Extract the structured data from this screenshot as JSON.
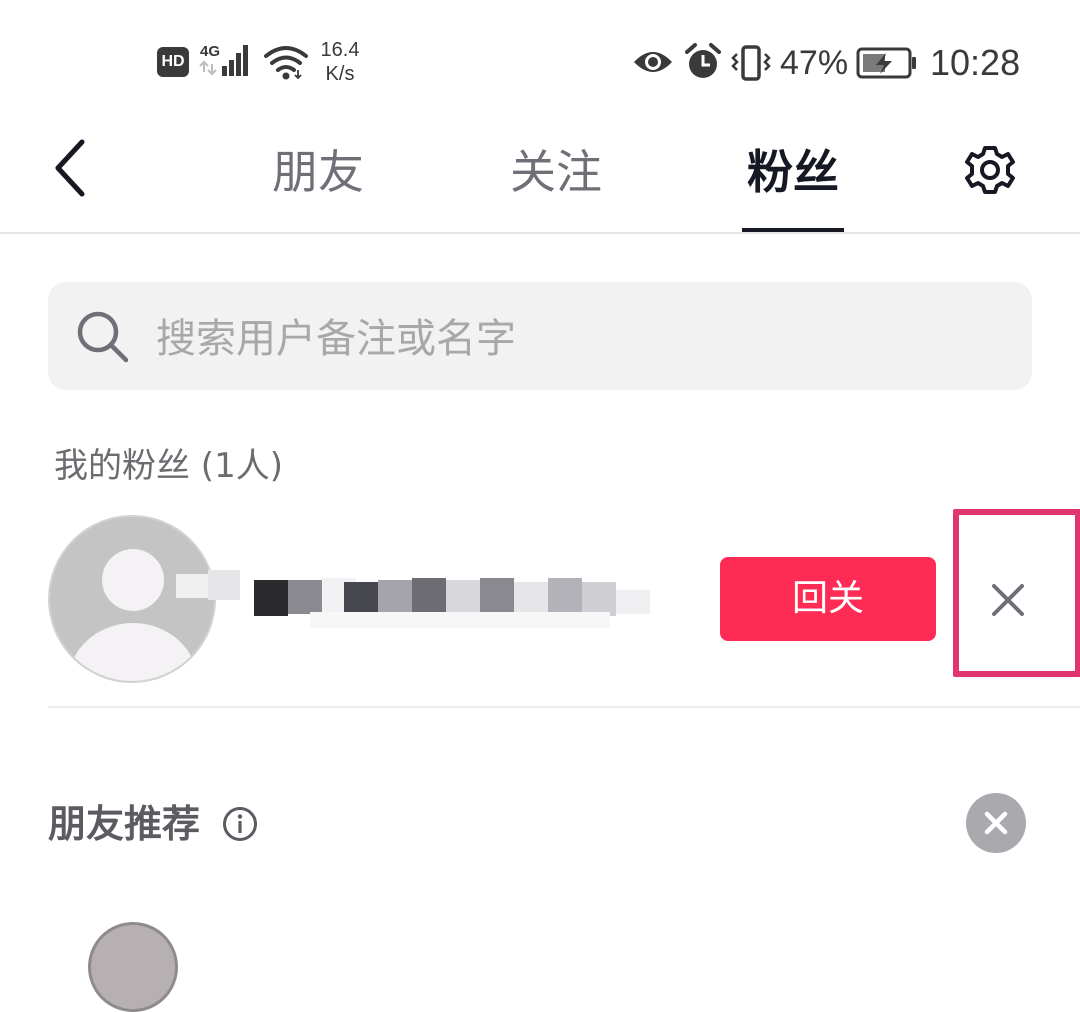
{
  "status_bar": {
    "hd_label": "HD",
    "network_label": "4G",
    "net_speed_value": "16.4",
    "net_speed_unit": "K/s",
    "battery_percent": "47%",
    "time": "10:28",
    "icons": [
      "hd-icon",
      "signal-icon",
      "wifi-icon",
      "eye-icon",
      "alarm-icon",
      "vibrate-icon",
      "battery-charging-icon"
    ]
  },
  "nav": {
    "tabs": [
      {
        "label": "朋友",
        "active": false
      },
      {
        "label": "关注",
        "active": false
      },
      {
        "label": "粉丝",
        "active": true
      }
    ],
    "icons": [
      "back-arrow-icon",
      "gear-icon"
    ]
  },
  "search": {
    "placeholder": "搜索用户备注或名字"
  },
  "fans": {
    "header": "我的粉丝 (1人)",
    "items": [
      {
        "username": "",
        "follow_back_label": "回关"
      }
    ]
  },
  "recommend": {
    "title": "朋友推荐"
  },
  "colors": {
    "accent": "#fe2c55",
    "highlight": "#e0356f",
    "text_primary": "#161823",
    "text_secondary": "#6f7077",
    "search_bg": "#f2f2f2"
  }
}
